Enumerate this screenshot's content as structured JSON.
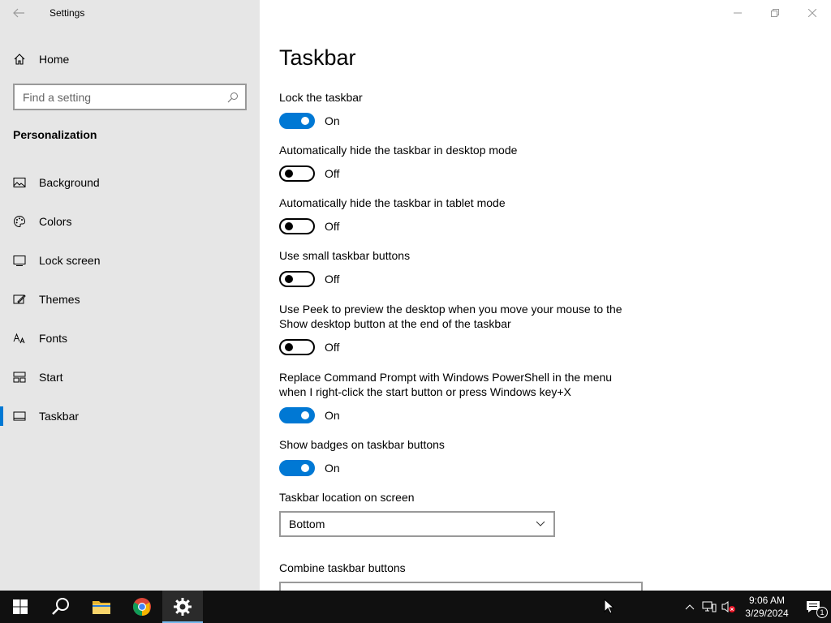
{
  "window": {
    "title": "Settings"
  },
  "sidebar": {
    "home_label": "Home",
    "search_placeholder": "Find a setting",
    "section_title": "Personalization",
    "items": [
      {
        "label": "Background",
        "icon": "image-icon"
      },
      {
        "label": "Colors",
        "icon": "palette-icon"
      },
      {
        "label": "Lock screen",
        "icon": "lock-screen-icon"
      },
      {
        "label": "Themes",
        "icon": "brush-icon"
      },
      {
        "label": "Fonts",
        "icon": "font-icon"
      },
      {
        "label": "Start",
        "icon": "start-grid-icon"
      },
      {
        "label": "Taskbar",
        "icon": "taskbar-icon",
        "active": true
      }
    ]
  },
  "main": {
    "title": "Taskbar",
    "settings": [
      {
        "label": "Lock the taskbar",
        "state": "On"
      },
      {
        "label": "Automatically hide the taskbar in desktop mode",
        "state": "Off"
      },
      {
        "label": "Automatically hide the taskbar in tablet mode",
        "state": "Off"
      },
      {
        "label": "Use small taskbar buttons",
        "state": "Off"
      },
      {
        "label": "Use Peek to preview the desktop when you move your mouse to the Show desktop button at the end of the taskbar",
        "state": "Off"
      },
      {
        "label": "Replace Command Prompt with Windows PowerShell in the menu when I right-click the start button or press Windows key+X",
        "state": "On"
      },
      {
        "label": "Show badges on taskbar buttons",
        "state": "On"
      }
    ],
    "location": {
      "label": "Taskbar location on screen",
      "value": "Bottom"
    },
    "combine": {
      "label": "Combine taskbar buttons"
    }
  },
  "taskbar": {
    "time": "9:06 AM",
    "date": "3/29/2024",
    "notification_count": "1"
  },
  "colors": {
    "accent": "#0078d4",
    "sidebar_bg": "#e6e6e6",
    "taskbar_bg": "#101010"
  }
}
